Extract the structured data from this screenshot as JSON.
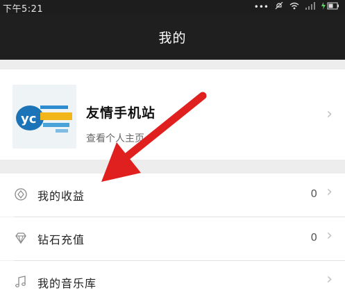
{
  "status_bar": {
    "time": "下午5:21",
    "icons": [
      "more-dots-icon",
      "mute-icon",
      "wifi-icon",
      "signal-icon",
      "battery-charging-icon"
    ]
  },
  "header": {
    "title": "我的"
  },
  "profile": {
    "name": "友情手机站",
    "subtitle": "查看个人主页",
    "avatar_icon": "site-logo-icon"
  },
  "menu": [
    {
      "label": "我的收益",
      "count": "0",
      "icon": "earnings-icon"
    },
    {
      "label": "钻石充值",
      "count": "0",
      "icon": "diamond-icon"
    },
    {
      "label": "我的音乐库",
      "count": "",
      "icon": "music-note-icon"
    }
  ],
  "colors": {
    "header_bg": "#1f1f1f",
    "annotation_arrow": "#e0201f",
    "background": "#f0f0f2"
  }
}
